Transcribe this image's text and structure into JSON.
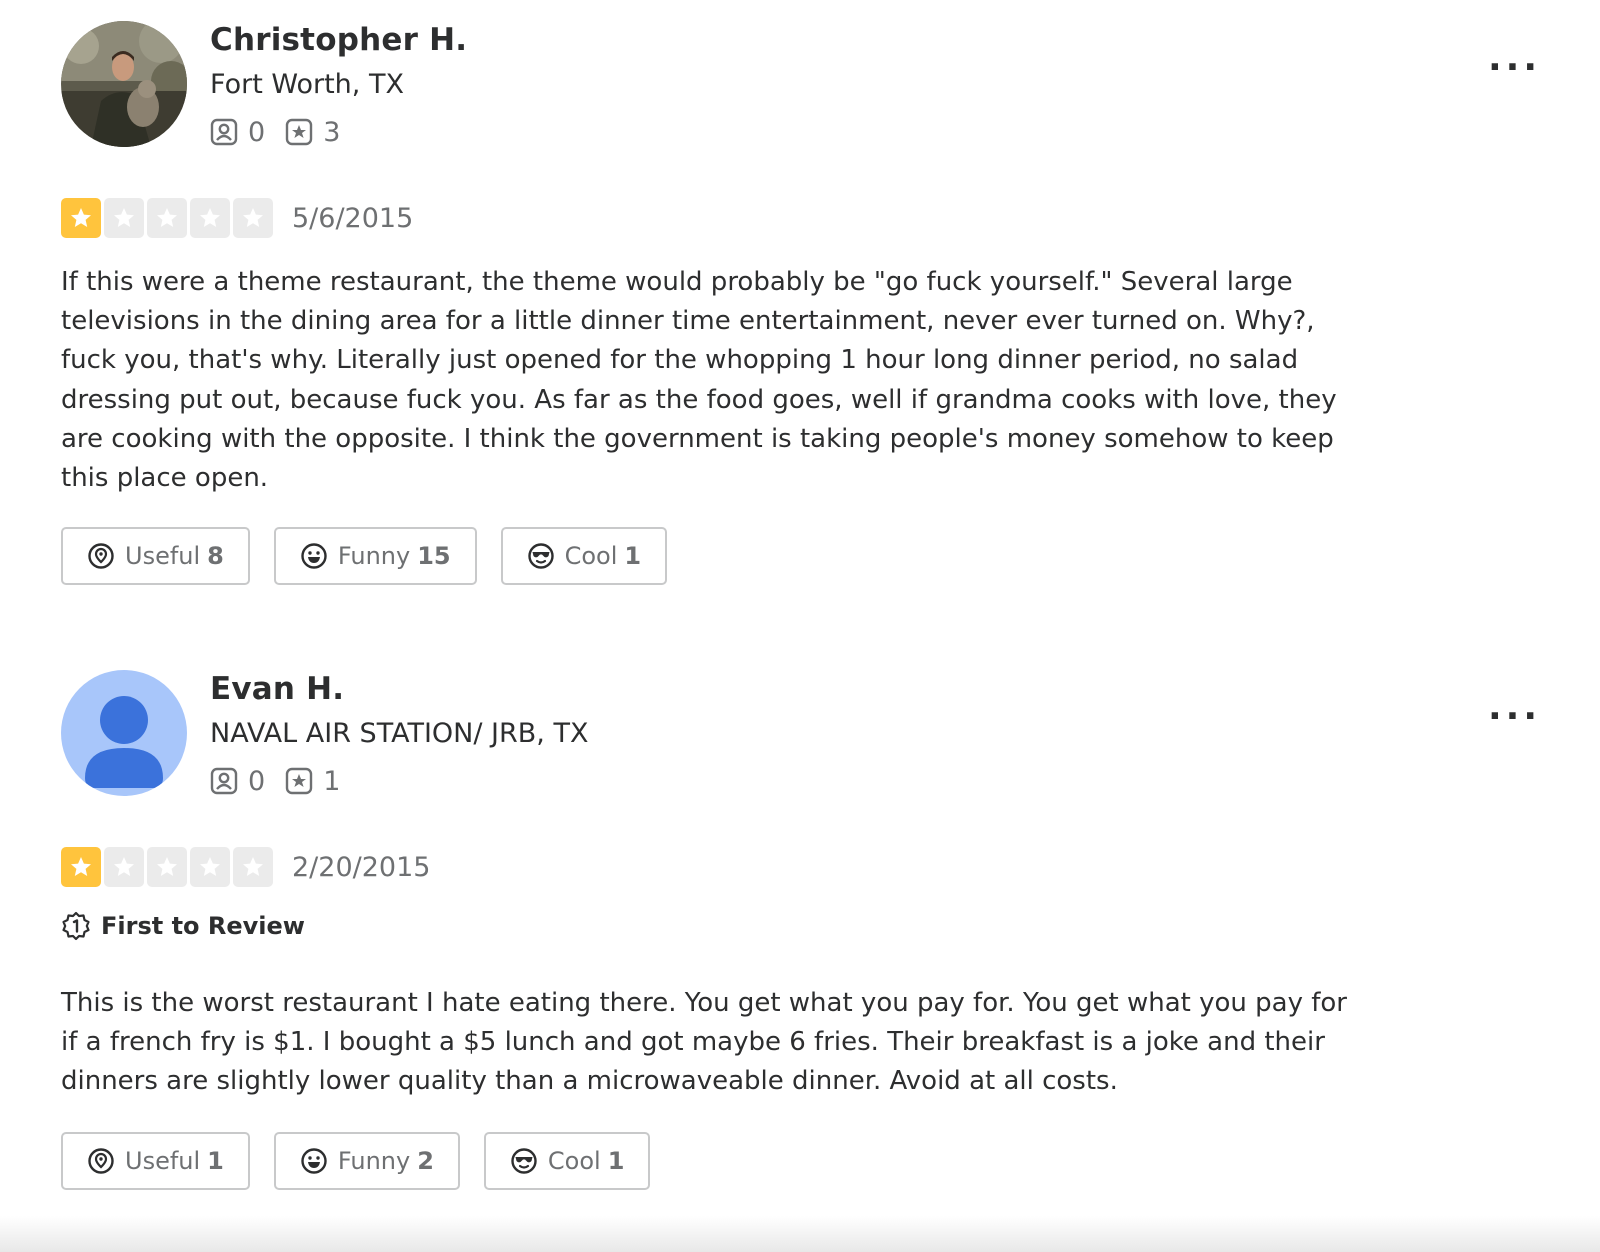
{
  "reviews": [
    {
      "user": {
        "name": "Christopher H.",
        "location": "Fort Worth, TX",
        "friends": "0",
        "reviews": "3",
        "avatar": "photo-avatar"
      },
      "rating": 1,
      "date": "5/6/2015",
      "badge": null,
      "text": "If this were a theme restaurant, the theme would probably be \"go fuck yourself.\" Several large televisions in the dining area for a little dinner time entertainment, never ever turned on. Why?, fuck you, that's why. Literally just opened for the whopping 1 hour long dinner period, no salad dressing put out, because fuck you. As far as the food goes, well if grandma cooks with love, they are cooking with the opposite. I think the government is taking people's money somehow to keep this place open.",
      "reactions": {
        "useful_label": "Useful",
        "useful": "8",
        "funny_label": "Funny",
        "funny": "15",
        "cool_label": "Cool",
        "cool": "1"
      },
      "more_label": "..."
    },
    {
      "user": {
        "name": "Evan H.",
        "location": "NAVAL AIR STATION/ JRB, TX",
        "friends": "0",
        "reviews": "1",
        "avatar": "default-avatar"
      },
      "rating": 1,
      "date": "2/20/2015",
      "badge": "First to Review",
      "text": "This is the worst restaurant I hate eating there. You get what you pay for. You get what you pay for if a french fry is $1. I bought a $5 lunch and got maybe 6 fries. Their breakfast is a joke and their dinners are slightly lower quality than a microwaveable dinner. Avoid at all costs.",
      "reactions": {
        "useful_label": "Useful",
        "useful": "1",
        "funny_label": "Funny",
        "funny": "2",
        "cool_label": "Cool",
        "cool": "1"
      },
      "more_label": "..."
    }
  ],
  "colors": {
    "star_on": "#ffc43d",
    "star_off": "#ebebeb",
    "avatar_default_bg": "#a8c6fa",
    "avatar_default_fg": "#3b72db"
  },
  "icons": {
    "friends": "friends-icon",
    "reviews": "review-count-icon",
    "useful": "useful-icon",
    "funny": "funny-icon",
    "cool": "cool-icon",
    "badge": "first-to-review-icon",
    "more": "more-options-icon",
    "star": "star-icon"
  }
}
